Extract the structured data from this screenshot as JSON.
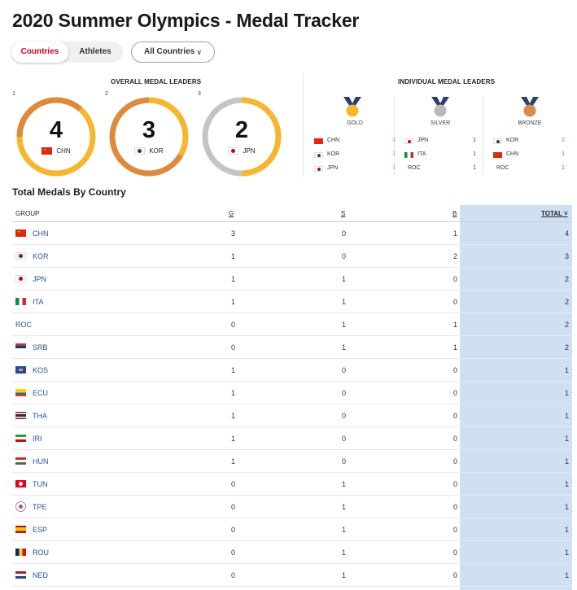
{
  "page": {
    "title": "2020 Summer Olympics - Medal Tracker"
  },
  "toggle": {
    "countries": "Countries",
    "athletes": "Athletes"
  },
  "filter": {
    "label": "All Countries"
  },
  "overall": {
    "heading": "OVERALL MEDAL LEADERS",
    "leaders": [
      {
        "rank": "1",
        "count": "4",
        "code": "CHN",
        "flag": "CHN"
      },
      {
        "rank": "2",
        "count": "3",
        "code": "KOR",
        "flag": "KOR"
      },
      {
        "rank": "3",
        "count": "2",
        "code": "JPN",
        "flag": "JPN"
      }
    ]
  },
  "individual": {
    "heading": "INDIVIDUAL MEDAL LEADERS",
    "gold": {
      "label": "GOLD",
      "rows": [
        {
          "code": "CHN",
          "count": "3"
        },
        {
          "code": "KOR",
          "count": "1"
        },
        {
          "code": "JPN",
          "count": "1"
        }
      ]
    },
    "silver": {
      "label": "SILVER",
      "rows": [
        {
          "code": "JPN",
          "count": "1"
        },
        {
          "code": "ITA",
          "count": "1"
        },
        {
          "code": "ROC",
          "count": "1"
        }
      ]
    },
    "bronze": {
      "label": "BRONZE",
      "rows": [
        {
          "code": "KOR",
          "count": "2"
        },
        {
          "code": "CHN",
          "count": "1"
        },
        {
          "code": "ROC",
          "count": "1"
        }
      ]
    }
  },
  "table": {
    "title": "Total Medals By Country",
    "headers": {
      "group": "GROUP",
      "g": "G",
      "s": "S",
      "b": "B",
      "total": "TOTAL ˅"
    },
    "rows": [
      {
        "code": "CHN",
        "g": "3",
        "s": "0",
        "b": "1",
        "total": "4"
      },
      {
        "code": "KOR",
        "g": "1",
        "s": "0",
        "b": "2",
        "total": "3"
      },
      {
        "code": "JPN",
        "g": "1",
        "s": "1",
        "b": "0",
        "total": "2"
      },
      {
        "code": "ITA",
        "g": "1",
        "s": "1",
        "b": "0",
        "total": "2"
      },
      {
        "code": "ROC",
        "g": "0",
        "s": "1",
        "b": "1",
        "total": "2"
      },
      {
        "code": "SRB",
        "g": "0",
        "s": "1",
        "b": "1",
        "total": "2"
      },
      {
        "code": "KOS",
        "g": "1",
        "s": "0",
        "b": "0",
        "total": "1"
      },
      {
        "code": "ECU",
        "g": "1",
        "s": "0",
        "b": "0",
        "total": "1"
      },
      {
        "code": "THA",
        "g": "1",
        "s": "0",
        "b": "0",
        "total": "1"
      },
      {
        "code": "IRI",
        "g": "1",
        "s": "0",
        "b": "0",
        "total": "1"
      },
      {
        "code": "HUN",
        "g": "1",
        "s": "0",
        "b": "0",
        "total": "1"
      },
      {
        "code": "TUN",
        "g": "0",
        "s": "1",
        "b": "0",
        "total": "1"
      },
      {
        "code": "TPE",
        "g": "0",
        "s": "1",
        "b": "0",
        "total": "1"
      },
      {
        "code": "ESP",
        "g": "0",
        "s": "1",
        "b": "0",
        "total": "1"
      },
      {
        "code": "ROU",
        "g": "0",
        "s": "1",
        "b": "0",
        "total": "1"
      },
      {
        "code": "NED",
        "g": "0",
        "s": "1",
        "b": "0",
        "total": "1"
      }
    ]
  },
  "colors": {
    "gold": "#f6b730",
    "silver": "#c4c4c4",
    "bronze": "#dd8a3f",
    "accent_red": "#d0021b",
    "link_blue": "#2a4f99",
    "total_col": "#cfe0f3"
  }
}
